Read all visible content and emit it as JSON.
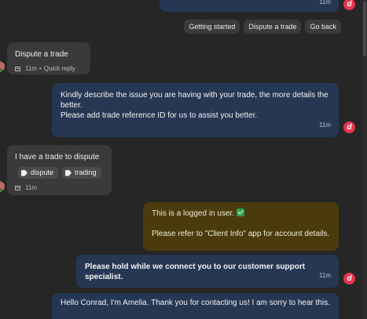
{
  "top_message": {
    "time": "11m"
  },
  "quick_replies": [
    "Getting started",
    "Dispute a trade",
    "Go back"
  ],
  "user_quick_reply": {
    "text": "Dispute a trade",
    "time": "11m",
    "source": "Quick reply"
  },
  "agent_describe": {
    "line1": "Kindly describe the issue you are having with your trade, the more details the better.",
    "line2": "Please add trade reference ID for us to assist you better.",
    "time": "11m"
  },
  "user_dispute": {
    "text": "I have a trade to dispute",
    "tags": [
      "dispute",
      "trading"
    ],
    "time": "11m"
  },
  "internal_note": {
    "line1": "This is a logged in user.",
    "line2": "Please refer to \"Client Info\" app for account details."
  },
  "hold_message": {
    "text": "Please hold while we connect you to our customer support specialist.",
    "time": "11m"
  },
  "greeting": {
    "text": "Hello Conrad, I'm Amelia. Thank you for contacting us! I am sorry to hear this."
  },
  "brand": {
    "letter": "d",
    "color": "#e8344e"
  }
}
